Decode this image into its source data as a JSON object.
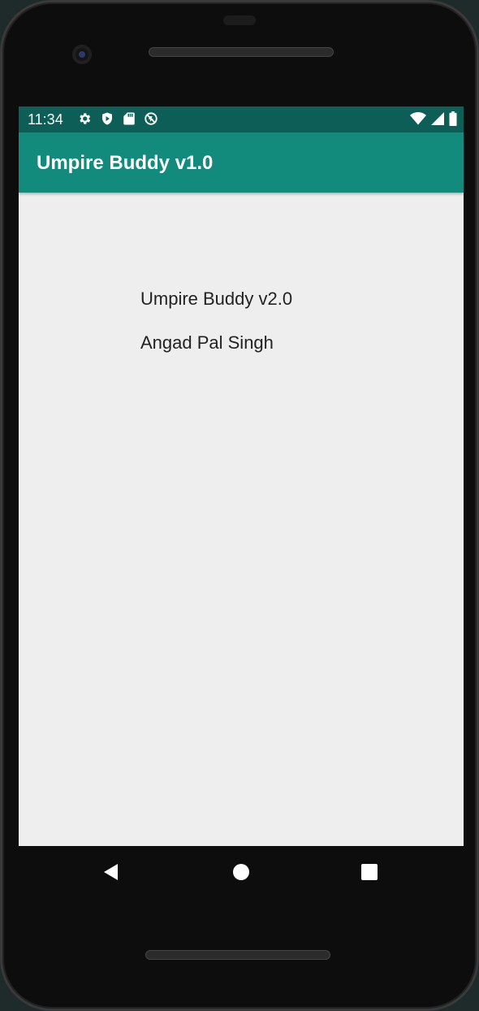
{
  "status_bar": {
    "time": "11:34",
    "left_icons": [
      "gear-icon",
      "shield-play-icon",
      "sd-card-icon",
      "data-saver-icon"
    ],
    "right_icons": [
      "wifi-icon",
      "cell-signal-icon",
      "battery-icon"
    ]
  },
  "app_bar": {
    "title": "Umpire Buddy v1.0",
    "color": "#128a7c",
    "status_color": "#0d5e56"
  },
  "content": {
    "app_name": "Umpire Buddy v2.0",
    "author": "Angad Pal Singh"
  },
  "nav_bar": {
    "buttons": [
      "back-icon",
      "home-icon",
      "recents-icon"
    ]
  }
}
